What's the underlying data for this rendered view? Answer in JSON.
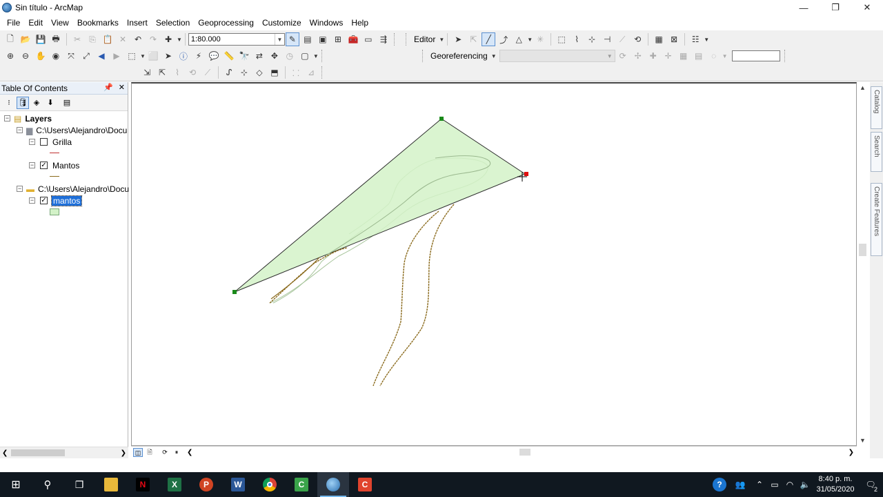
{
  "window": {
    "title": "Sin título - ArcMap",
    "controls": [
      "—",
      "❐",
      "✕"
    ]
  },
  "menus": [
    "File",
    "Edit",
    "View",
    "Bookmarks",
    "Insert",
    "Selection",
    "Geoprocessing",
    "Customize",
    "Windows",
    "Help"
  ],
  "toolbar": {
    "scale_value": "1:80.000",
    "editor_label": "Editor",
    "georeferencing_label": "Georeferencing"
  },
  "toc": {
    "title": "Table Of Contents",
    "root_label": "Layers",
    "group1_path": "C:\\Users\\Alejandro\\Docu",
    "layer_grilla": "Grilla",
    "layer_mantos": "Mantos",
    "group2_path": "C:\\Users\\Alejandro\\Docu",
    "layer_mantos_selected": "mantos",
    "checked": {
      "grilla": false,
      "mantos": true,
      "mantos_selected": true
    }
  },
  "side_tabs": [
    "Catalog",
    "Search",
    "Create Features"
  ],
  "taskbar": {
    "apps": [
      "windows-start",
      "search",
      "task-view",
      "file-explorer",
      "netflix",
      "excel",
      "powerpoint",
      "word",
      "chrome",
      "camtasia-recorder",
      "arcmap",
      "camtasia"
    ],
    "clock_time": "8:40 p. m.",
    "clock_date": "31/05/2020",
    "notification_count": "2"
  },
  "colors": {
    "polygon_fill": "#d3f2c8",
    "polygon_outline": "#2b2b2b",
    "contour": "#8a6a1c",
    "vertex": "#1a8a1a",
    "last_vertex": "#e01010",
    "selection_blue": "#1e6fd9"
  }
}
